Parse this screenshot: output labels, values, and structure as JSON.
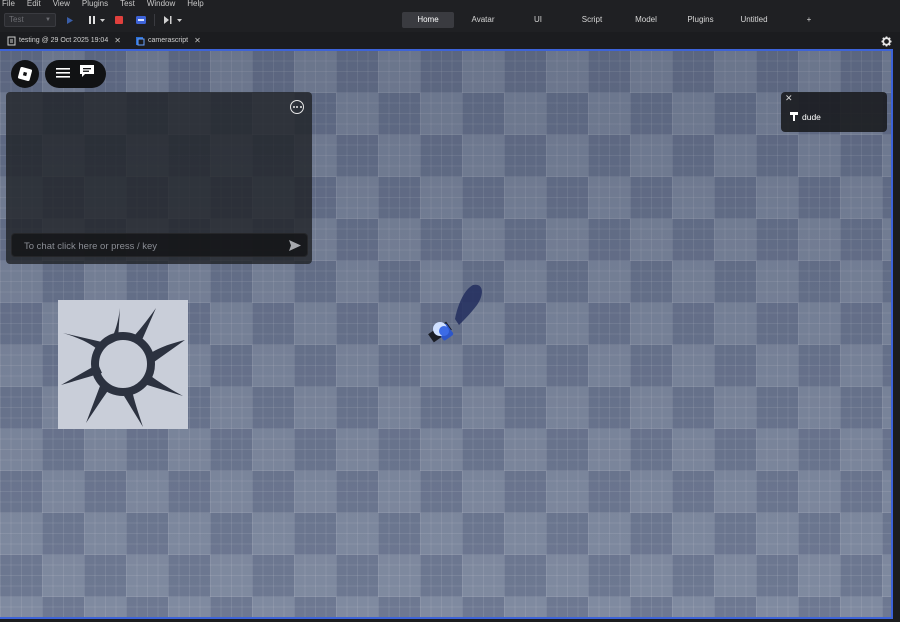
{
  "menu": [
    "File",
    "Edit",
    "View",
    "Plugins",
    "Test",
    "Window",
    "Help"
  ],
  "toolbar": {
    "mode_value": "Test",
    "tabs": [
      "Home",
      "Avatar",
      "UI",
      "Script",
      "Model",
      "Plugins",
      "Untitled",
      "+"
    ],
    "active_tab": "Home"
  },
  "doc_tabs": [
    {
      "label": "testing @ 29 Oct 2025 19:04",
      "icon": "place-file-icon"
    },
    {
      "label": "camerascript",
      "icon": "script-icon"
    }
  ],
  "chat": {
    "placeholder": "To chat click here or press / key"
  },
  "players": {
    "names": [
      "dude"
    ]
  },
  "colors": {
    "accent_border": "#3d63d8",
    "active_tab_bg": "#3a3b40",
    "stop_button": "#e0403d",
    "play_button": "#4a7de2"
  }
}
